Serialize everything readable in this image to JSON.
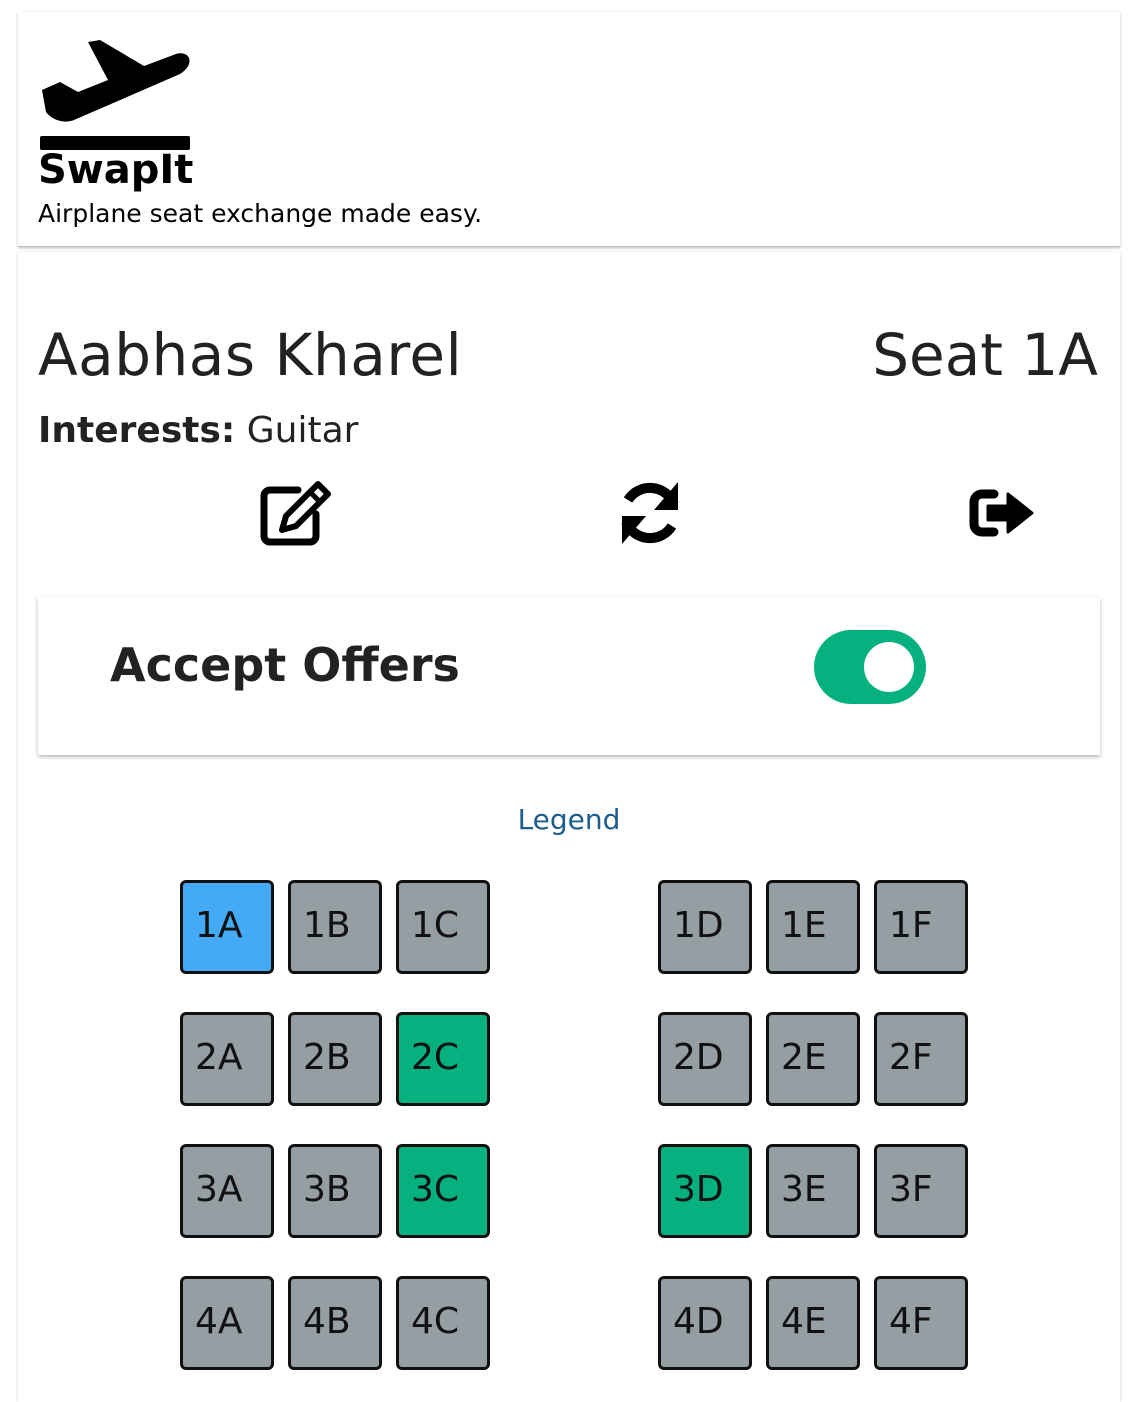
{
  "header": {
    "brand_name": "SwapIt",
    "tagline": "Airplane seat exchange made easy.",
    "logo_icon": "airplane-departure-icon"
  },
  "profile": {
    "name": "Aabhas Kharel",
    "seat": "Seat 1A",
    "interests_label": "Interests:",
    "interests_value": "Guitar"
  },
  "actions": [
    {
      "icon": "edit-icon"
    },
    {
      "icon": "sync-icon"
    },
    {
      "icon": "sign-out-icon"
    }
  ],
  "accept_offers": {
    "label": "Accept Offers",
    "enabled": true
  },
  "legend": {
    "label": "Legend"
  },
  "colors": {
    "own_seat": "#45aaf6",
    "available_seat": "#07b07f",
    "occupied_seat": "#959ea3",
    "toggle_on": "#07b07f",
    "link": "#1d5d8e"
  },
  "seat_map": {
    "rows": [
      {
        "seats": [
          {
            "label": "1A",
            "status": "own"
          },
          {
            "label": "1B",
            "status": "occupied"
          },
          {
            "label": "1C",
            "status": "occupied"
          },
          {
            "label": "1D",
            "status": "occupied"
          },
          {
            "label": "1E",
            "status": "occupied"
          },
          {
            "label": "1F",
            "status": "occupied"
          }
        ]
      },
      {
        "seats": [
          {
            "label": "2A",
            "status": "occupied"
          },
          {
            "label": "2B",
            "status": "occupied"
          },
          {
            "label": "2C",
            "status": "available"
          },
          {
            "label": "2D",
            "status": "occupied"
          },
          {
            "label": "2E",
            "status": "occupied"
          },
          {
            "label": "2F",
            "status": "occupied"
          }
        ]
      },
      {
        "seats": [
          {
            "label": "3A",
            "status": "occupied"
          },
          {
            "label": "3B",
            "status": "occupied"
          },
          {
            "label": "3C",
            "status": "available"
          },
          {
            "label": "3D",
            "status": "available"
          },
          {
            "label": "3E",
            "status": "occupied"
          },
          {
            "label": "3F",
            "status": "occupied"
          }
        ]
      },
      {
        "seats": [
          {
            "label": "4A",
            "status": "occupied"
          },
          {
            "label": "4B",
            "status": "occupied"
          },
          {
            "label": "4C",
            "status": "occupied"
          },
          {
            "label": "4D",
            "status": "occupied"
          },
          {
            "label": "4E",
            "status": "occupied"
          },
          {
            "label": "4F",
            "status": "occupied"
          }
        ]
      }
    ]
  }
}
